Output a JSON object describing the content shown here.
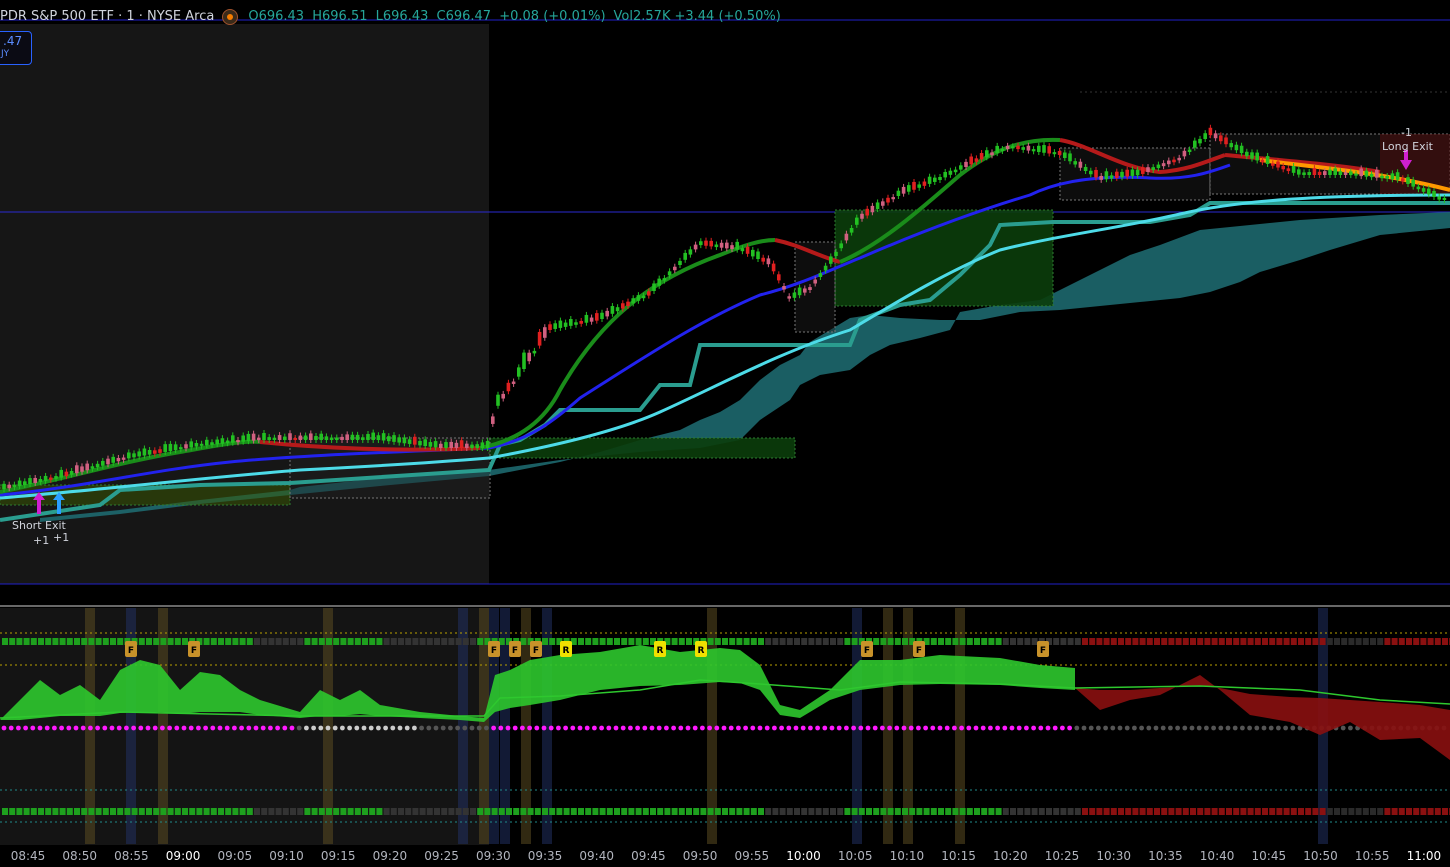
{
  "header": {
    "title": "PDR S&P 500 ETF · 1 · NYSE Arca",
    "open": "O696.43",
    "high": "H696.51",
    "low": "L696.43",
    "close": "C696.47",
    "change": "+0.08 (+0.01%)",
    "volume": "Vol2.57K",
    "volume_change": "+3.44 (+0.50%)"
  },
  "price_tag": {
    "price": ".47",
    "side": "JY"
  },
  "annotations": {
    "short_exit": "Short Exit",
    "short_exit_qty": "+1",
    "long_entry_qty": "+1",
    "long_exit": "Long Exit",
    "long_exit_qty": "-1"
  },
  "time_axis": [
    "08:45",
    "08:50",
    "08:55",
    "09:00",
    "09:05",
    "09:10",
    "09:15",
    "09:20",
    "09:25",
    "09:30",
    "09:35",
    "09:40",
    "09:45",
    "09:50",
    "09:55",
    "10:00",
    "10:05",
    "10:10",
    "10:15",
    "10:20",
    "10:25",
    "10:30",
    "10:35",
    "10:40",
    "10:45",
    "10:50",
    "10:55",
    "11:00"
  ],
  "time_axis_hours": [
    "09:00",
    "10:00",
    "11:00"
  ],
  "markers": {
    "f_label": "F",
    "r_label": "R"
  },
  "colors": {
    "background": "#000000",
    "premarket_bg": "#161616",
    "blue_line": "#2020ff",
    "accent_green": "#26a69a",
    "magenta": "#ff00ff"
  }
}
